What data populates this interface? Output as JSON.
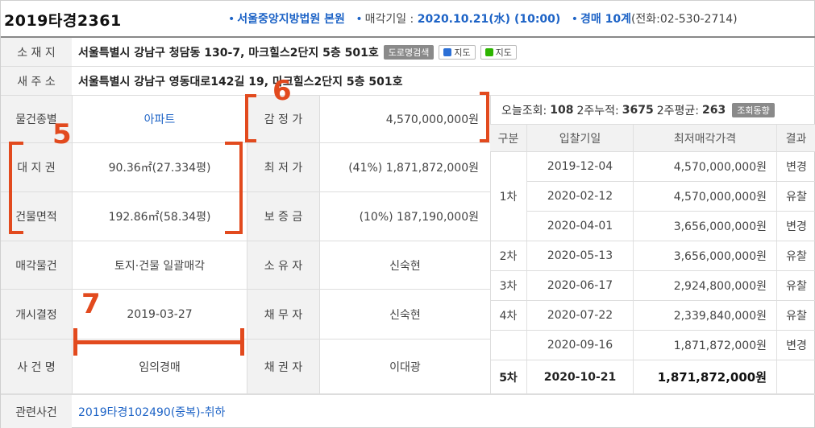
{
  "header": {
    "case_number": "2019타경2361",
    "court": "서울중앙지방법원 본원",
    "sale_date_label": "매각기일 :",
    "sale_date": "2020.10.21(水) (10:00)",
    "dept": "경매 10계",
    "phone": "(전화:02-530-2714)"
  },
  "address": {
    "label": "소 재 지",
    "value": "서울특별시 강남구 청담동 130-7, 마크힐스2단지 5층 501호",
    "btn_road": "도로명검색",
    "btn_map1": "지도",
    "btn_map2": "지도"
  },
  "new_address": {
    "label": "새 주 소",
    "value": "서울특별시 강남구 영동대로142길 19, 마크힐스2단지 5층 501호"
  },
  "left_rows": [
    {
      "label": "물건종별",
      "value": "아파트",
      "label2": "감 정 가",
      "value2": "4,570,000,000원"
    },
    {
      "label": "대 지 권",
      "value": "90.36㎡(27.334평)",
      "label2": "최 저 가",
      "value2": "(41%) 1,871,872,000원"
    },
    {
      "label": "건물면적",
      "value": "192.86㎡(58.34평)",
      "label2": "보 증 금",
      "value2": "(10%) 187,190,000원"
    },
    {
      "label": "매각물건",
      "value": "토지·건물 일괄매각",
      "label2": "소 유 자",
      "value2": "신숙현"
    },
    {
      "label": "개시결정",
      "value": "2019-03-27",
      "label2": "채 무 자",
      "value2": "신숙현"
    },
    {
      "label": "사 건 명",
      "value": "임의경매",
      "label2": "채 권 자",
      "value2": "이대광"
    }
  ],
  "related": {
    "label": "관련사건",
    "value": "2019타경102490(중복)-취하"
  },
  "stats": {
    "today_label": "오늘조회:",
    "today": "108",
    "two_week_label": "2주누적:",
    "two_week": "3675",
    "avg_label": "2주평균:",
    "avg": "263",
    "btn": "조회동향"
  },
  "bid_table": {
    "headers": [
      "구분",
      "입찰기일",
      "최저매각가격",
      "결과"
    ],
    "rows": [
      {
        "round": "",
        "date": "2019-12-04",
        "price": "4,570,000,000원",
        "result": "변경"
      },
      {
        "round": "1차",
        "date": "2020-02-12",
        "price": "4,570,000,000원",
        "result": "유찰"
      },
      {
        "round": "",
        "date": "2020-04-01",
        "price": "3,656,000,000원",
        "result": "변경"
      },
      {
        "round": "2차",
        "date": "2020-05-13",
        "price": "3,656,000,000원",
        "result": "유찰"
      },
      {
        "round": "3차",
        "date": "2020-06-17",
        "price": "2,924,800,000원",
        "result": "유찰"
      },
      {
        "round": "4차",
        "date": "2020-07-22",
        "price": "2,339,840,000원",
        "result": "유찰"
      },
      {
        "round": "",
        "date": "2020-09-16",
        "price": "1,871,872,000원",
        "result": "변경"
      },
      {
        "round": "5차",
        "date": "2020-10-21",
        "price": "1,871,872,000원",
        "result": ""
      }
    ]
  },
  "annotations": {
    "n5": "5",
    "n6": "6",
    "n7": "7",
    "color": "#e24a1e"
  }
}
